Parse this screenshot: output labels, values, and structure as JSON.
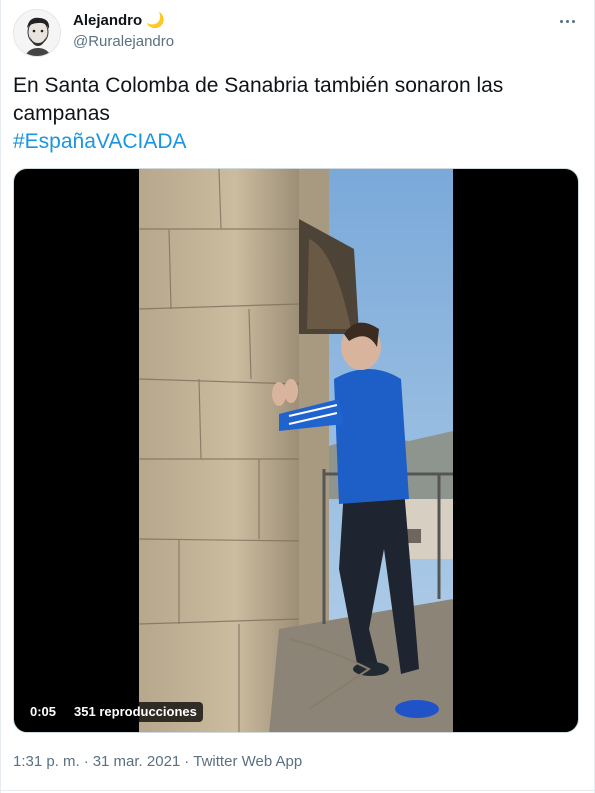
{
  "tweet": {
    "author": {
      "display_name": "Alejandro",
      "emoji": "🌙",
      "handle": "@Ruralejandro",
      "avatar_icon": "avatar-illustration"
    },
    "more_icon": "more-dots-icon",
    "text": "En Santa Colomba de Sanabria también sonaron las campanas",
    "hashtag": "#EspañaVACIADA",
    "media": {
      "type": "video",
      "time": "0:05",
      "views": "351 reproducciones"
    },
    "meta": {
      "time": "1:31 p. m.",
      "separator1": "·",
      "date": "31 mar. 2021",
      "separator2": "·",
      "source": "Twitter Web App"
    }
  },
  "colors": {
    "link": "#1b95e0",
    "secondary_text": "#5b7083",
    "primary_text": "#0f1419"
  }
}
